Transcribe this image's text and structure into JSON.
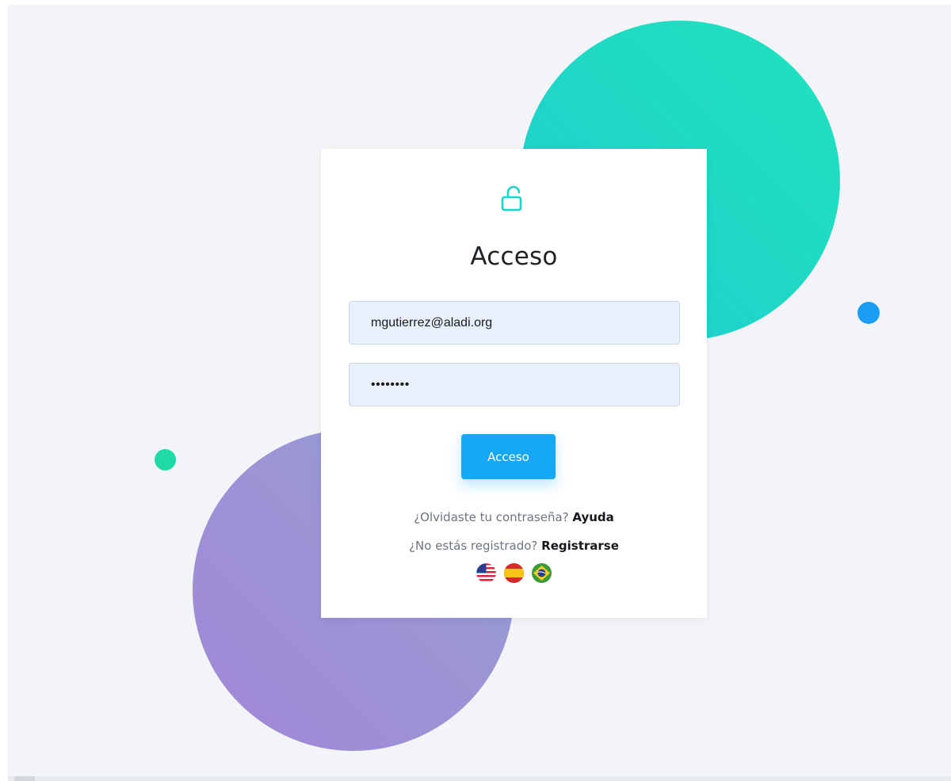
{
  "login": {
    "title": "Acceso",
    "email_value": "mgutierrez@aladi.org",
    "password_value": "12345678",
    "submit_label": "Acceso",
    "forgot_text": "¿Olvidaste tu contraseña?",
    "forgot_link": "Ayuda",
    "register_text": "¿No estás registrado?",
    "register_link": "Registrarse"
  },
  "language_flags": [
    "us-flag-icon",
    "spain-flag-icon",
    "brazil-flag-icon"
  ],
  "icons": {
    "header": "unlock-icon"
  },
  "colors": {
    "accent": "#16a8f5",
    "lock_icon": "#20d2c8",
    "background": "#f2f4f7",
    "teal_circle": "#1fd9c4",
    "purple_circle": "#9c94d5",
    "blue_dot": "#1a9ef5",
    "green_dot": "#1fd9a6",
    "input_fill": "#e8f0fe"
  }
}
